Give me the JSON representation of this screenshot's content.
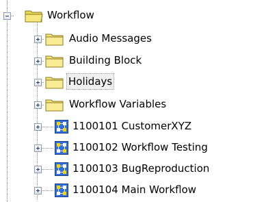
{
  "tree": {
    "root": {
      "label": "Workflow",
      "icon": "folder-open-icon",
      "expanded": true
    },
    "children": [
      {
        "label": "Audio Messages",
        "icon": "folder-icon",
        "expander": "plus"
      },
      {
        "label": "Building Block",
        "icon": "folder-icon",
        "expander": "plus"
      },
      {
        "label": "Holidays",
        "icon": "folder-icon",
        "expander": "plus",
        "selected": true
      },
      {
        "label": "Workflow Variables",
        "icon": "folder-icon",
        "expander": "plus"
      },
      {
        "label": "1100101 CustomerXYZ",
        "icon": "workflow-icon",
        "expander": "plus"
      },
      {
        "label": "1100102 Workflow Testing",
        "icon": "workflow-icon",
        "expander": "plus"
      },
      {
        "label": "1100103 BugReproduction",
        "icon": "workflow-icon",
        "expander": "plus"
      },
      {
        "label": "1100104 Main Workflow",
        "icon": "workflow-icon",
        "expander": "plus"
      }
    ]
  },
  "colors": {
    "folder": "#f2e27a",
    "folder_edge": "#8c7a1e",
    "workflow_blue": "#2f6fe0",
    "workflow_yellow": "#f5d400",
    "selection_bg": "#f0f0f0"
  }
}
